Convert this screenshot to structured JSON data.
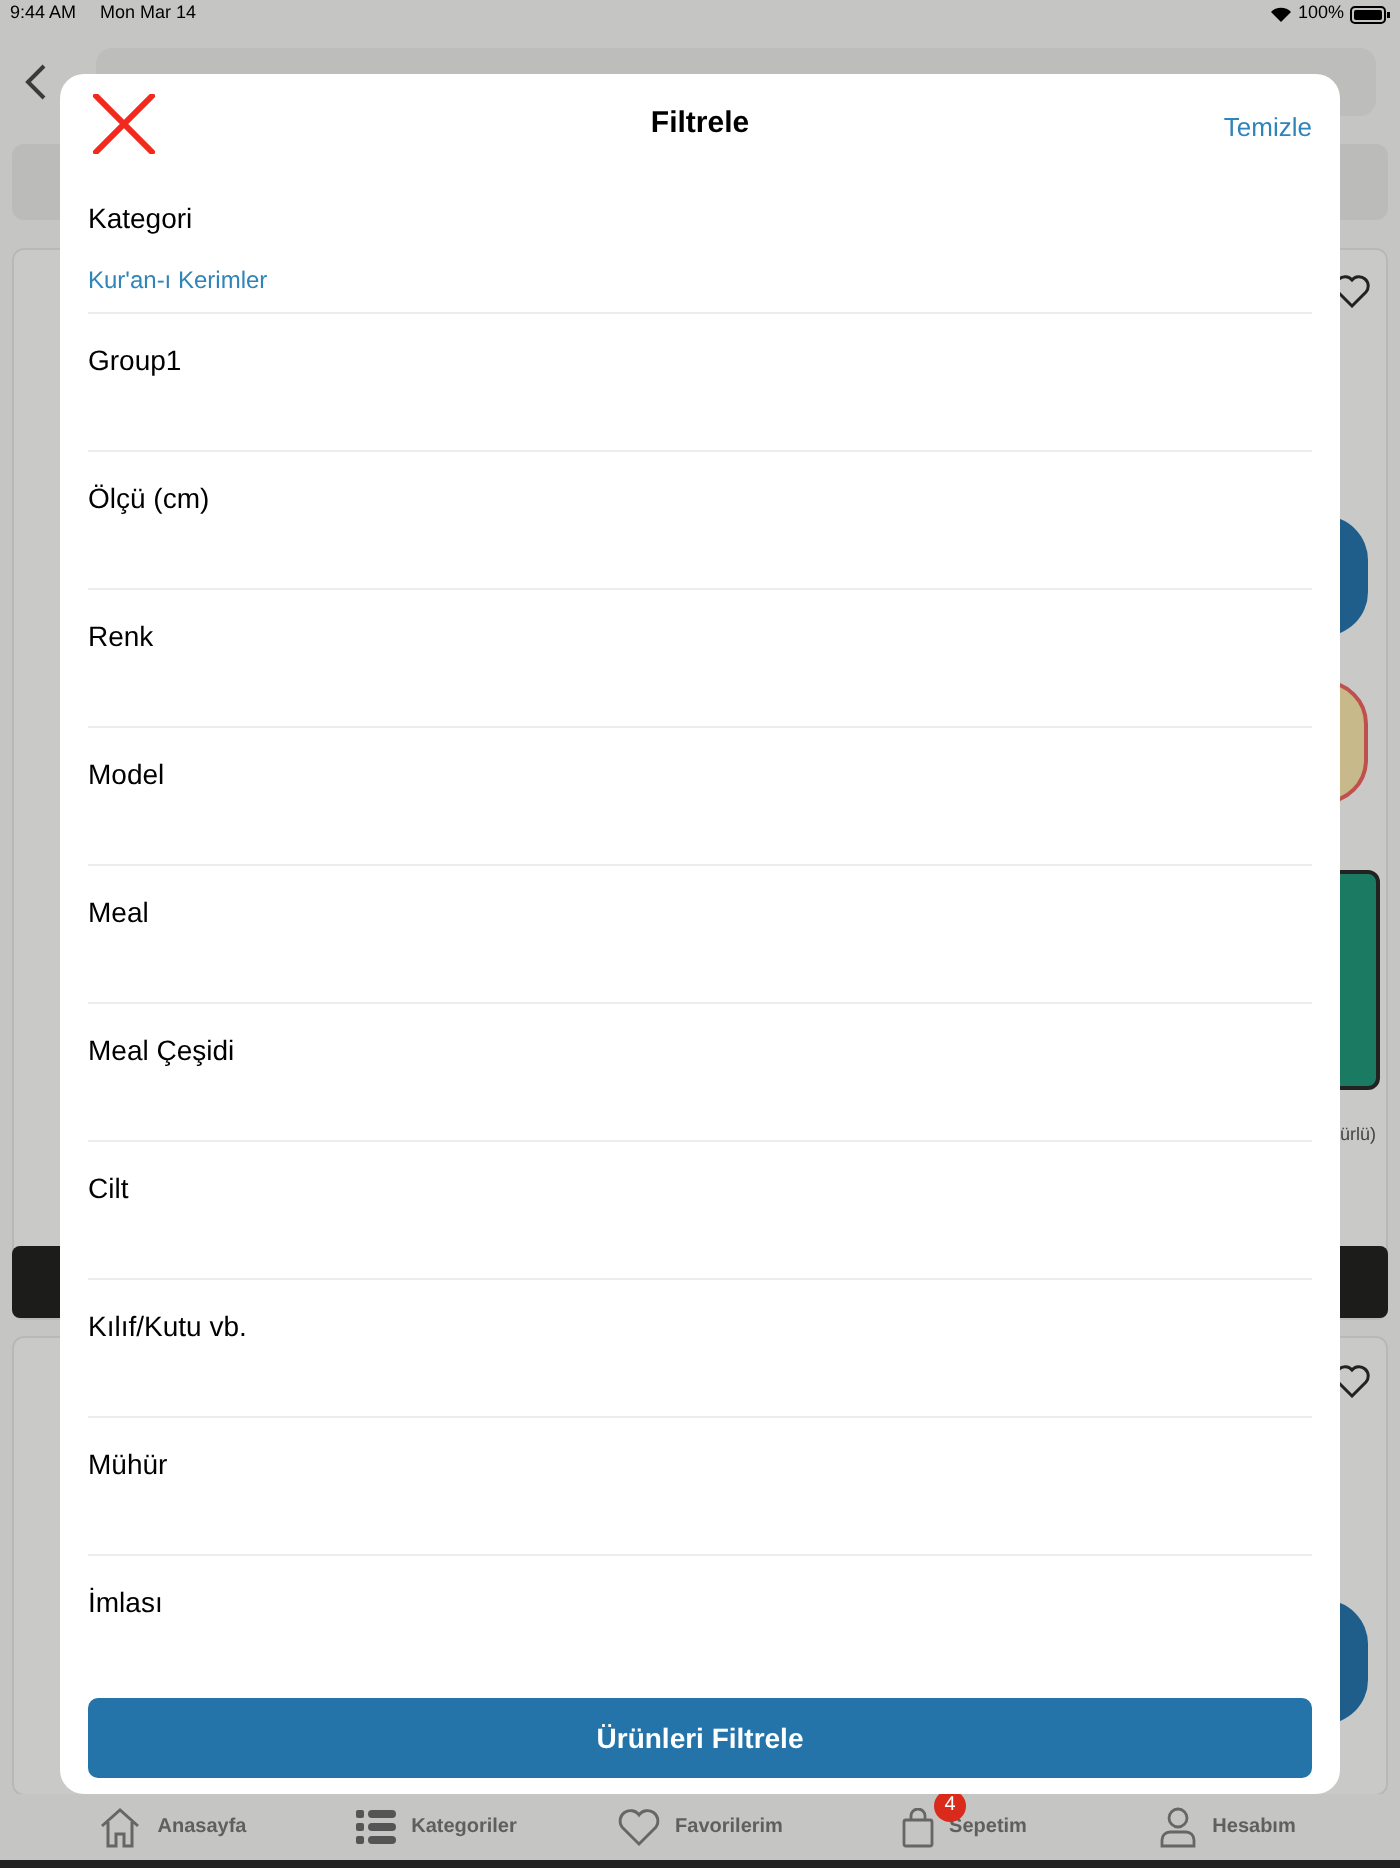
{
  "status_bar": {
    "time": "9:44 AM",
    "date": "Mon Mar 14",
    "battery": "100%"
  },
  "background_page": {
    "product_text": "ürlü)"
  },
  "filter_sheet": {
    "title": "Filtrele",
    "clear_link": "Temizle",
    "filters": [
      {
        "label": "Kategori",
        "value": "Kur'an-ı Kerimler"
      },
      {
        "label": "Group1"
      },
      {
        "label": "Ölçü (cm)"
      },
      {
        "label": "Renk"
      },
      {
        "label": "Model"
      },
      {
        "label": "Meal"
      },
      {
        "label": "Meal Çeşidi"
      },
      {
        "label": "Cilt"
      },
      {
        "label": "Kılıf/Kutu vb."
      },
      {
        "label": "Mühür"
      },
      {
        "label": "İmlası"
      }
    ],
    "apply_button": "Ürünleri Filtrele"
  },
  "tab_bar": {
    "items": [
      {
        "label": "Anasayfa"
      },
      {
        "label": "Kategoriler"
      },
      {
        "label": "Favorilerim"
      },
      {
        "label": "Sepetim",
        "badge": "4"
      },
      {
        "label": "Hesabım"
      }
    ]
  }
}
